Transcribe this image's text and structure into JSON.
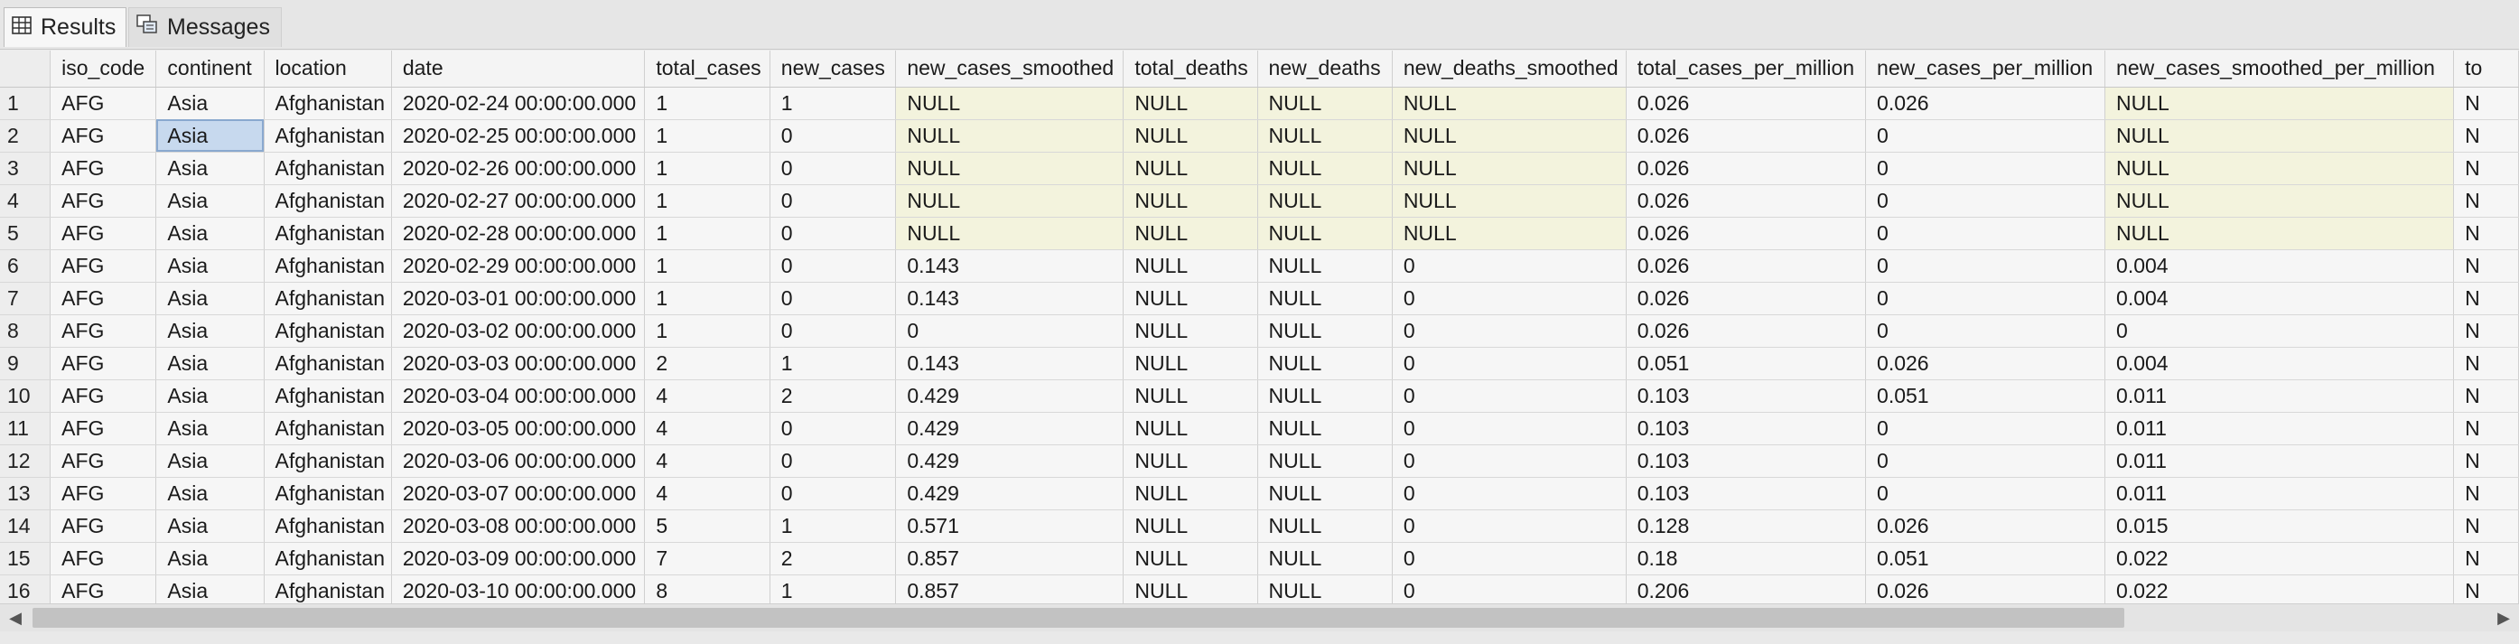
{
  "tabs": [
    {
      "label": "Results",
      "icon": "grid-icon",
      "active": true
    },
    {
      "label": "Messages",
      "icon": "messages-icon",
      "active": false
    }
  ],
  "columns": [
    "iso_code",
    "continent",
    "location",
    "date",
    "total_cases",
    "new_cases",
    "new_cases_smoothed",
    "total_deaths",
    "new_deaths",
    "new_deaths_smoothed",
    "total_cases_per_million",
    "new_cases_per_million",
    "new_cases_smoothed_per_million",
    "to"
  ],
  "rows": [
    [
      "1",
      "AFG",
      "Asia",
      "Afghanistan",
      "2020-02-24 00:00:00.000",
      "1",
      "1",
      "NULL",
      "NULL",
      "NULL",
      "NULL",
      "0.026",
      "0.026",
      "NULL",
      "N"
    ],
    [
      "2",
      "AFG",
      "Asia",
      "Afghanistan",
      "2020-02-25 00:00:00.000",
      "1",
      "0",
      "NULL",
      "NULL",
      "NULL",
      "NULL",
      "0.026",
      "0",
      "NULL",
      "N"
    ],
    [
      "3",
      "AFG",
      "Asia",
      "Afghanistan",
      "2020-02-26 00:00:00.000",
      "1",
      "0",
      "NULL",
      "NULL",
      "NULL",
      "NULL",
      "0.026",
      "0",
      "NULL",
      "N"
    ],
    [
      "4",
      "AFG",
      "Asia",
      "Afghanistan",
      "2020-02-27 00:00:00.000",
      "1",
      "0",
      "NULL",
      "NULL",
      "NULL",
      "NULL",
      "0.026",
      "0",
      "NULL",
      "N"
    ],
    [
      "5",
      "AFG",
      "Asia",
      "Afghanistan",
      "2020-02-28 00:00:00.000",
      "1",
      "0",
      "NULL",
      "NULL",
      "NULL",
      "NULL",
      "0.026",
      "0",
      "NULL",
      "N"
    ],
    [
      "6",
      "AFG",
      "Asia",
      "Afghanistan",
      "2020-02-29 00:00:00.000",
      "1",
      "0",
      "0.143",
      "NULL",
      "NULL",
      "0",
      "0.026",
      "0",
      "0.004",
      "N"
    ],
    [
      "7",
      "AFG",
      "Asia",
      "Afghanistan",
      "2020-03-01 00:00:00.000",
      "1",
      "0",
      "0.143",
      "NULL",
      "NULL",
      "0",
      "0.026",
      "0",
      "0.004",
      "N"
    ],
    [
      "8",
      "AFG",
      "Asia",
      "Afghanistan",
      "2020-03-02 00:00:00.000",
      "1",
      "0",
      "0",
      "NULL",
      "NULL",
      "0",
      "0.026",
      "0",
      "0",
      "N"
    ],
    [
      "9",
      "AFG",
      "Asia",
      "Afghanistan",
      "2020-03-03 00:00:00.000",
      "2",
      "1",
      "0.143",
      "NULL",
      "NULL",
      "0",
      "0.051",
      "0.026",
      "0.004",
      "N"
    ],
    [
      "10",
      "AFG",
      "Asia",
      "Afghanistan",
      "2020-03-04 00:00:00.000",
      "4",
      "2",
      "0.429",
      "NULL",
      "NULL",
      "0",
      "0.103",
      "0.051",
      "0.011",
      "N"
    ],
    [
      "11",
      "AFG",
      "Asia",
      "Afghanistan",
      "2020-03-05 00:00:00.000",
      "4",
      "0",
      "0.429",
      "NULL",
      "NULL",
      "0",
      "0.103",
      "0",
      "0.011",
      "N"
    ],
    [
      "12",
      "AFG",
      "Asia",
      "Afghanistan",
      "2020-03-06 00:00:00.000",
      "4",
      "0",
      "0.429",
      "NULL",
      "NULL",
      "0",
      "0.103",
      "0",
      "0.011",
      "N"
    ],
    [
      "13",
      "AFG",
      "Asia",
      "Afghanistan",
      "2020-03-07 00:00:00.000",
      "4",
      "0",
      "0.429",
      "NULL",
      "NULL",
      "0",
      "0.103",
      "0",
      "0.011",
      "N"
    ],
    [
      "14",
      "AFG",
      "Asia",
      "Afghanistan",
      "2020-03-08 00:00:00.000",
      "5",
      "1",
      "0.571",
      "NULL",
      "NULL",
      "0",
      "0.128",
      "0.026",
      "0.015",
      "N"
    ],
    [
      "15",
      "AFG",
      "Asia",
      "Afghanistan",
      "2020-03-09 00:00:00.000",
      "7",
      "2",
      "0.857",
      "NULL",
      "NULL",
      "0",
      "0.18",
      "0.051",
      "0.022",
      "N"
    ],
    [
      "16",
      "AFG",
      "Asia",
      "Afghanistan",
      "2020-03-10 00:00:00.000",
      "8",
      "1",
      "0.857",
      "NULL",
      "NULL",
      "0",
      "0.206",
      "0.026",
      "0.022",
      "N"
    ]
  ],
  "selected_cell": {
    "row": 1,
    "col": 2
  },
  "colors": {
    "selection": "#c7d9ee",
    "highlight": "#f3f3dd",
    "grid_bg": "#f6f6f6"
  }
}
